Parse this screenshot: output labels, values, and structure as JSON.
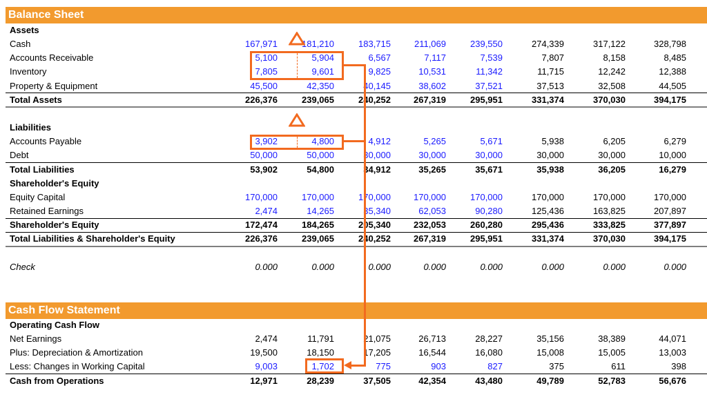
{
  "balance_sheet": {
    "title": "Balance Sheet",
    "rows": [
      {
        "label": "Assets",
        "style": "bold",
        "values": []
      },
      {
        "label": "Cash",
        "style": "",
        "values": [
          "167,971",
          "181,210",
          "183,715",
          "211,069",
          "239,550",
          "274,339",
          "317,122",
          "328,798"
        ],
        "blue": 5
      },
      {
        "label": "Accounts Receivable",
        "style": "",
        "values": [
          "5,100",
          "5,904",
          "6,567",
          "7,117",
          "7,539",
          "7,807",
          "8,158",
          "8,485"
        ],
        "blue": 5
      },
      {
        "label": "Inventory",
        "style": "",
        "values": [
          "7,805",
          "9,601",
          "9,825",
          "10,531",
          "11,342",
          "11,715",
          "12,242",
          "12,388"
        ],
        "blue": 5
      },
      {
        "label": "Property & Equipment",
        "style": "",
        "values": [
          "45,500",
          "42,350",
          "40,145",
          "38,602",
          "37,521",
          "37,513",
          "32,508",
          "44,505"
        ],
        "blue": 5
      },
      {
        "label": "Total Assets",
        "style": "bold",
        "values": [
          "226,376",
          "239,065",
          "240,252",
          "267,319",
          "295,951",
          "331,374",
          "370,030",
          "394,175"
        ],
        "blue": 0
      },
      {
        "label": "",
        "style": "",
        "values": []
      },
      {
        "label": "Liabilities",
        "style": "bold",
        "values": []
      },
      {
        "label": "Accounts Payable",
        "style": "",
        "values": [
          "3,902",
          "4,800",
          "4,912",
          "5,265",
          "5,671",
          "5,938",
          "6,205",
          "6,279"
        ],
        "blue": 5
      },
      {
        "label": "Debt",
        "style": "",
        "values": [
          "50,000",
          "50,000",
          "30,000",
          "30,000",
          "30,000",
          "30,000",
          "30,000",
          "10,000"
        ],
        "blue": 5
      },
      {
        "label": "Total Liabilities",
        "style": "bold",
        "values": [
          "53,902",
          "54,800",
          "34,912",
          "35,265",
          "35,671",
          "35,938",
          "36,205",
          "16,279"
        ],
        "blue": 0
      },
      {
        "label": "Shareholder's Equity",
        "style": "bold",
        "values": []
      },
      {
        "label": "Equity Capital",
        "style": "",
        "values": [
          "170,000",
          "170,000",
          "170,000",
          "170,000",
          "170,000",
          "170,000",
          "170,000",
          "170,000"
        ],
        "blue": 5
      },
      {
        "label": "Retained Earnings",
        "style": "",
        "values": [
          "2,474",
          "14,265",
          "35,340",
          "62,053",
          "90,280",
          "125,436",
          "163,825",
          "207,897"
        ],
        "blue": 5
      },
      {
        "label": "Shareholder's Equity",
        "style": "bold",
        "values": [
          "172,474",
          "184,265",
          "205,340",
          "232,053",
          "260,280",
          "295,436",
          "333,825",
          "377,897"
        ],
        "blue": 0
      },
      {
        "label": "Total Liabilities & Shareholder's Equity",
        "style": "bold",
        "values": [
          "226,376",
          "239,065",
          "240,252",
          "267,319",
          "295,951",
          "331,374",
          "370,030",
          "394,175"
        ],
        "blue": 0
      },
      {
        "label": "",
        "style": "",
        "values": []
      },
      {
        "label": "Check",
        "style": "ital",
        "values": [
          "0.000",
          "0.000",
          "0.000",
          "0.000",
          "0.000",
          "0.000",
          "0.000",
          "0.000"
        ],
        "blue": 0
      }
    ]
  },
  "cash_flow": {
    "title": "Cash Flow Statement",
    "rows": [
      {
        "label": "Operating Cash Flow",
        "style": "bold",
        "values": []
      },
      {
        "label": "Net Earnings",
        "style": "",
        "values": [
          "2,474",
          "11,791",
          "21,075",
          "26,713",
          "28,227",
          "35,156",
          "38,389",
          "44,071"
        ],
        "blue": 0
      },
      {
        "label": "Plus: Depreciation & Amortization",
        "style": "",
        "values": [
          "19,500",
          "18,150",
          "17,205",
          "16,544",
          "16,080",
          "15,008",
          "15,005",
          "13,003"
        ],
        "blue": 0
      },
      {
        "label": "Less: Changes in Working Capital",
        "style": "",
        "values": [
          "9,003",
          "1,702",
          "775",
          "903",
          "827",
          "375",
          "611",
          "398"
        ],
        "blue": 5
      },
      {
        "label": "Cash from Operations",
        "style": "bold",
        "values": [
          "12,971",
          "28,239",
          "37,505",
          "42,354",
          "43,480",
          "49,789",
          "52,783",
          "56,676"
        ],
        "blue": 0
      }
    ]
  },
  "colors": {
    "header": "#f29a2e",
    "accent": "#f26a1f",
    "input": "#1a1aff"
  }
}
